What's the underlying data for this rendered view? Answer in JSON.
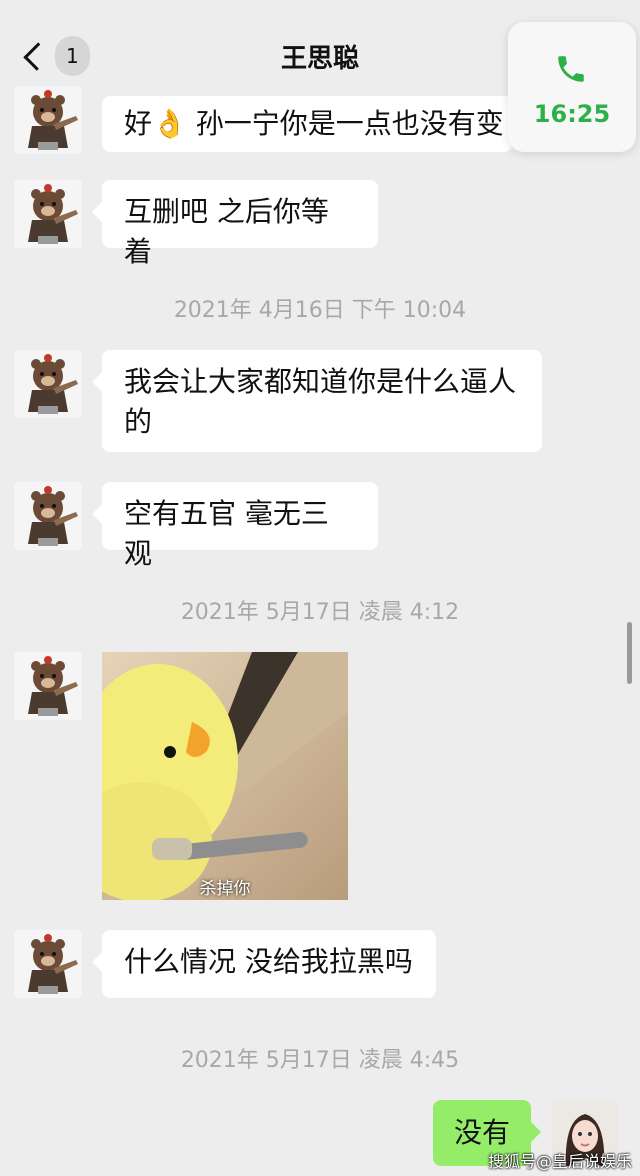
{
  "header": {
    "unread_count": "1",
    "title": "王思聪"
  },
  "call": {
    "duration": "16:25",
    "icon": "phone-icon",
    "color": "#2bb04a"
  },
  "messages": [
    {
      "text": "好👌 孙一宁你是一点也没有变"
    },
    {
      "text": "互删吧 之后你等着"
    },
    {
      "text": "我会让大家都知道你是什么逼人的"
    },
    {
      "text": "空有五官 毫无三观"
    },
    {
      "image_caption": "杀掉你"
    },
    {
      "text": "什么情况 没给我拉黑吗"
    },
    {
      "text": "没有"
    }
  ],
  "timestamps": [
    "2021年 4月16日 下午 10:04",
    "2021年 5月17日 凌晨 4:12",
    "2021年 5月17日 凌晨 4:45"
  ],
  "watermark": "搜狐号@皇后说娱乐",
  "colors": {
    "background": "#ededed",
    "my_bubble": "#95ec69",
    "bubble": "#ffffff"
  }
}
